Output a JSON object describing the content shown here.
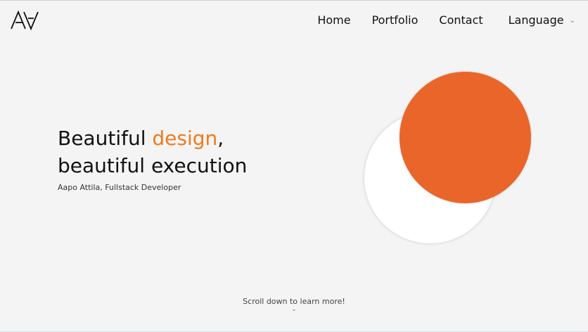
{
  "header": {
    "logo_icon": "aa-logo-icon",
    "nav": {
      "home": "Home",
      "portfolio": "Portfolio",
      "contact": "Contact",
      "language": "Language"
    }
  },
  "hero": {
    "title_line1_prefix": "Beautiful ",
    "title_line1_accent": "design",
    "title_line1_suffix": ",",
    "title_line2": "beautiful execution",
    "subtitle": "Aapo Attila, Fullstack Developer"
  },
  "graphic": {
    "white_circle_color": "#ffffff",
    "orange_circle_color": "#e9652a",
    "accent_color": "#f07a1c"
  },
  "footer": {
    "scroll_hint": "Scroll down to learn more!",
    "scroll_icon": "chevron-down-icon"
  }
}
